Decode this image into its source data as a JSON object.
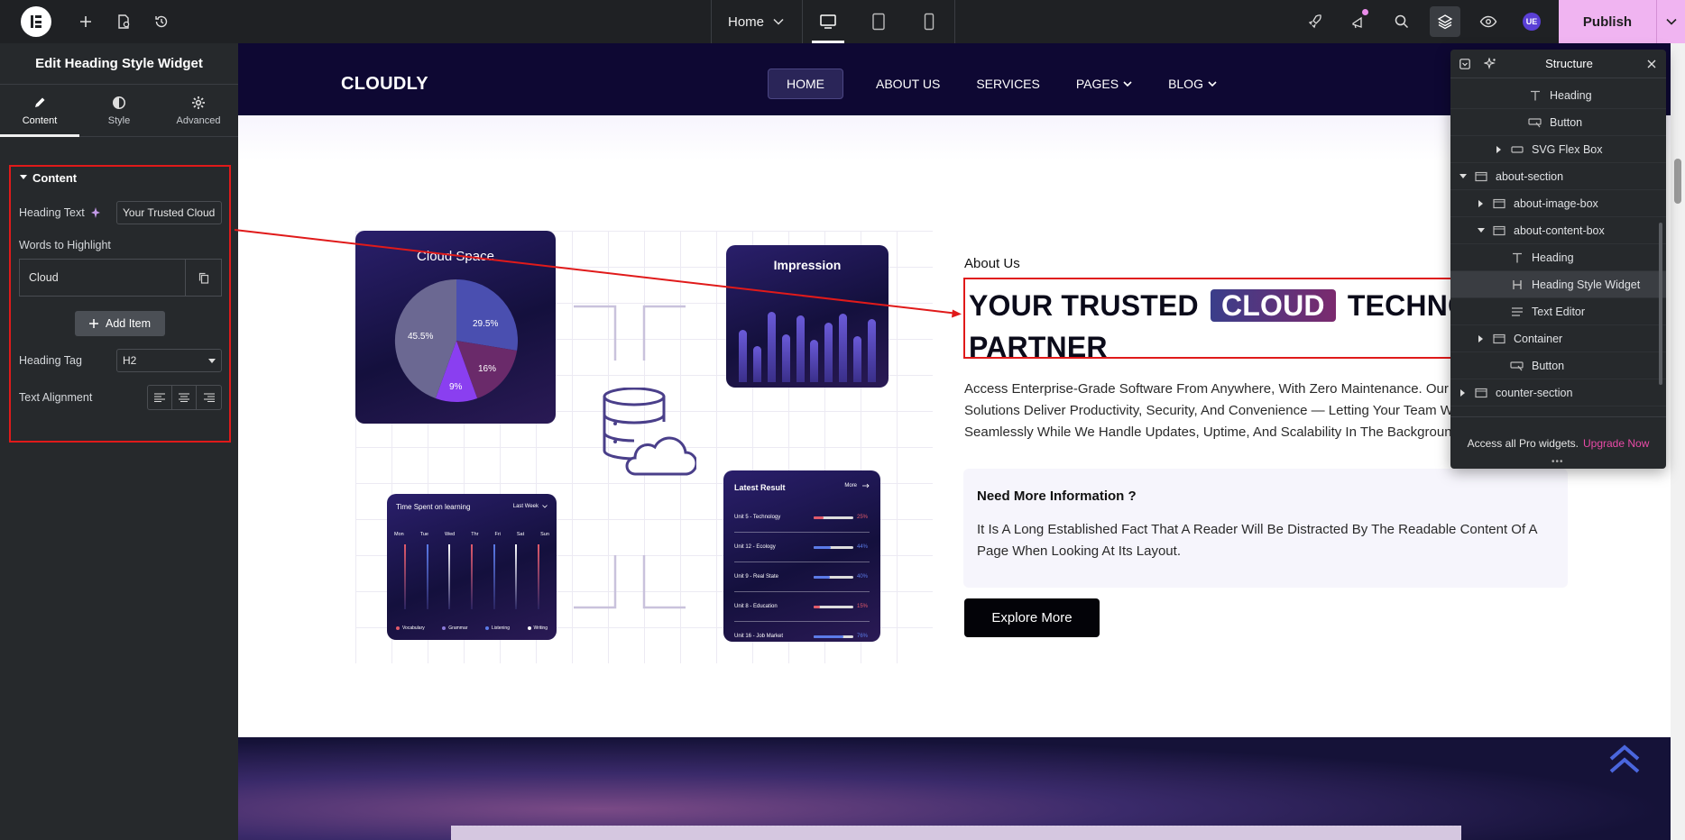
{
  "topbar": {
    "page_name": "Home",
    "publish_label": "Publish",
    "user_badge": "UE"
  },
  "panel": {
    "title": "Edit Heading Style Widget",
    "tabs": [
      {
        "label": "Content",
        "icon": "pencil-icon",
        "active": true
      },
      {
        "label": "Style",
        "icon": "half-circle-icon",
        "active": false
      },
      {
        "label": "Advanced",
        "icon": "gear-icon",
        "active": false
      }
    ],
    "section_title": "Content",
    "heading_text_label": "Heading Text",
    "heading_text_value": "Your Trusted Cloud",
    "words_label": "Words to Highlight",
    "words_item": "Cloud",
    "add_item_label": "Add Item",
    "heading_tag_label": "Heading Tag",
    "heading_tag_value": "H2",
    "text_alignment_label": "Text Alignment"
  },
  "site": {
    "brand": "CLOUDLY",
    "menu": [
      {
        "label": "HOME",
        "active": true,
        "dropdown": false
      },
      {
        "label": "ABOUT US",
        "active": false,
        "dropdown": false
      },
      {
        "label": "SERVICES",
        "active": false,
        "dropdown": false
      },
      {
        "label": "PAGES",
        "active": false,
        "dropdown": true
      },
      {
        "label": "BLOG",
        "active": false,
        "dropdown": true
      }
    ],
    "about_label": "About Us",
    "heading_before": "YOUR TRUSTED",
    "heading_highlight": "CLOUD",
    "heading_after": "TECHNOLOGY",
    "heading_line2": "PARTNER",
    "paragraph_lines": [
      "Access Enterprise-Grade Software From Anywhere, With Zero Maintenance. Our Cloud",
      "Solutions Deliver Productivity, Security, And Convenience — Letting Your Team Work",
      "Seamlessly While We Handle Updates, Uptime, And Scalability In The Background."
    ],
    "info_title": "Need More Information ?",
    "info_text": "It Is A Long Established Fact That A Reader Will Be Distracted By The Readable Content Of A Page When Looking At Its Layout.",
    "explore_label": "Explore More",
    "cards": {
      "cloud_space": {
        "title": "Cloud Space",
        "slices": [
          {
            "label": "29.5%",
            "value": 29.5
          },
          {
            "label": "16%",
            "value": 16
          },
          {
            "label": "9%",
            "value": 9
          },
          {
            "label": "45.5%",
            "value": 45.5
          }
        ]
      },
      "impression": {
        "title": "Impression",
        "bars": [
          0.55,
          0.38,
          0.74,
          0.5,
          0.7,
          0.44,
          0.62,
          0.72,
          0.48,
          0.66
        ]
      },
      "time_spent": {
        "title": "Time Spent on learning",
        "filter": "Last Week",
        "days": [
          "Mon",
          "Tue",
          "Wed",
          "Thr",
          "Fri",
          "Sat",
          "Sun"
        ],
        "legend": [
          "Vocabulary",
          "Grammar",
          "Listening",
          "Writing"
        ]
      },
      "latest_result": {
        "title": "Latest Result",
        "more": "More",
        "rows": [
          {
            "label": "Unit 5 - Technology",
            "value": "25%",
            "color": "#e25a6a"
          },
          {
            "label": "Unit 12 - Ecology",
            "value": "44%",
            "color": "#5b7be8"
          },
          {
            "label": "Unit 9 - Real State",
            "value": "40%",
            "color": "#5b7be8"
          },
          {
            "label": "Unit 8 - Education",
            "value": "15%",
            "color": "#e25a6a"
          },
          {
            "label": "Unit 16 - Job Market",
            "value": "76%",
            "color": "#5b7be8"
          }
        ]
      }
    }
  },
  "structure": {
    "title": "Structure",
    "rows": [
      {
        "label": "Heading",
        "indent": 3,
        "icon": "text-icon",
        "caret": ""
      },
      {
        "label": "Button",
        "indent": 3,
        "icon": "button-icon",
        "caret": ""
      },
      {
        "label": "SVG Flex Box",
        "indent": 2,
        "icon": "flexbox-icon",
        "caret": "right"
      },
      {
        "label": "about-section",
        "indent": 0,
        "icon": "container-icon",
        "caret": "down"
      },
      {
        "label": "about-image-box",
        "indent": 1,
        "icon": "container-icon",
        "caret": "right"
      },
      {
        "label": "about-content-box",
        "indent": 1,
        "icon": "container-icon",
        "caret": "down"
      },
      {
        "label": "Heading",
        "indent": 2,
        "icon": "text-icon",
        "caret": ""
      },
      {
        "label": "Heading Style Widget",
        "indent": 2,
        "icon": "heading-icon",
        "caret": "",
        "selected": true
      },
      {
        "label": "Text Editor",
        "indent": 2,
        "icon": "text-editor-icon",
        "caret": ""
      },
      {
        "label": "Container",
        "indent": 1,
        "icon": "container-icon",
        "caret": "right"
      },
      {
        "label": "Button",
        "indent": 2,
        "icon": "button-icon",
        "caret": ""
      },
      {
        "label": "counter-section",
        "indent": 0,
        "icon": "container-icon",
        "caret": "right"
      }
    ],
    "footer_text": "Access all Pro widgets.",
    "footer_link": "Upgrade Now"
  }
}
